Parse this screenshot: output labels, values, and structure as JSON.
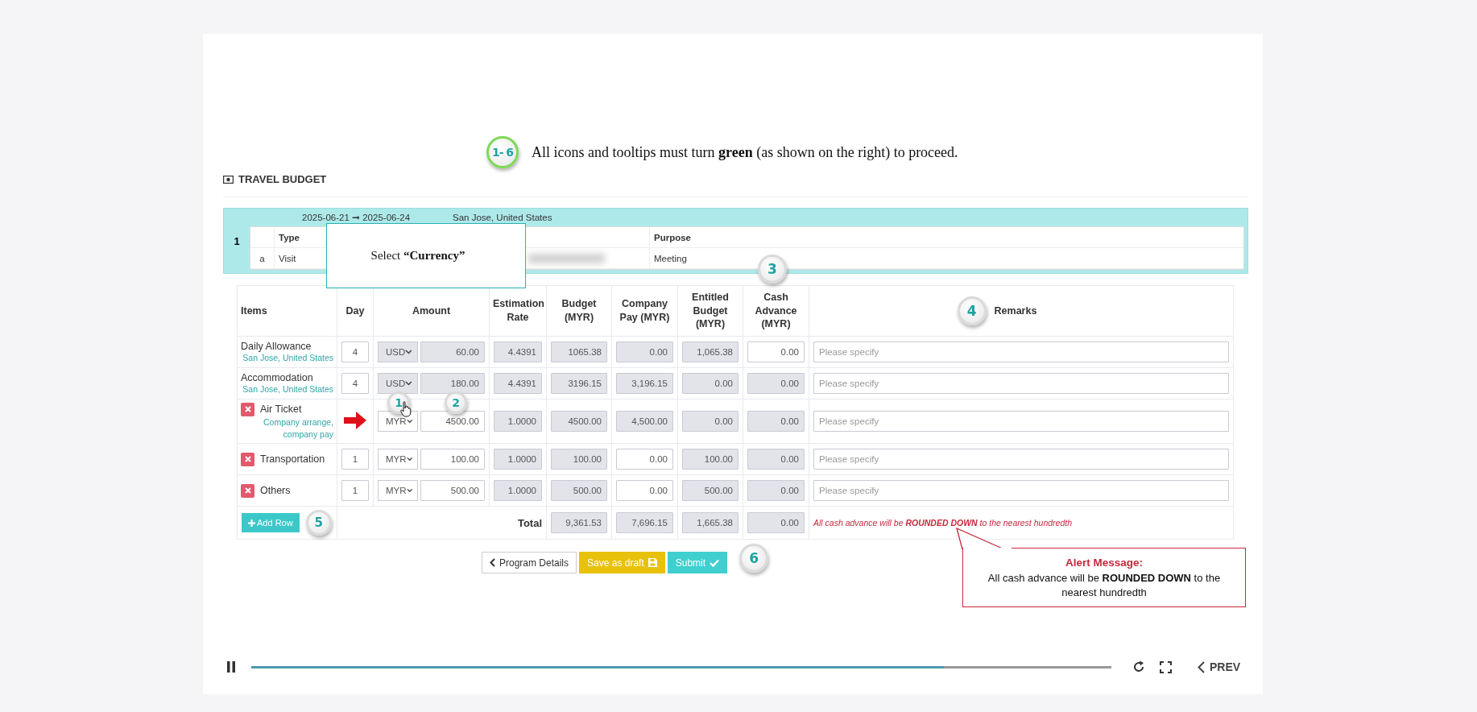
{
  "instruction": {
    "badge": "1- 6",
    "text": "All icons and tooltips must turn **green** (as shown on the right) to proceed."
  },
  "section_title": "TRAVEL BUDGET",
  "trip": {
    "number": "1",
    "dates": "2025-06-21 ➞ 2025-06-24",
    "location": "San Jose, United States",
    "headers": [
      "Type",
      "Purpose"
    ],
    "row": {
      "letter": "a",
      "type": "Visit",
      "purpose": "Meeting"
    }
  },
  "tooltip": "Select **“Currency”**",
  "steps": [
    "1",
    "2",
    "3",
    "4",
    "5",
    "6"
  ],
  "budget_table": {
    "columns": [
      "Items",
      "Day",
      "Amount",
      "Estimation Rate",
      "Budget (MYR)",
      "Company Pay (MYR)",
      "Entitled Budget (MYR)",
      "Cash Advance (MYR)",
      "Remarks"
    ],
    "rows": [
      {
        "kind": "fixed",
        "item": "Daily Allowance",
        "detail": "San Jose, United States",
        "pointer": false,
        "day": "4",
        "currency": "USD",
        "amount": "60.00",
        "locked": true,
        "rate": "4.4391",
        "budget": "1065.38",
        "company_pay": "0.00",
        "company_pay_locked": true,
        "entitled": "1,065.38",
        "cash_advance": "0.00",
        "cash_advance_locked": false,
        "remarks_placeholder": "Please specify"
      },
      {
        "kind": "fixed",
        "item": "Accommodation",
        "detail": "San Jose, United States",
        "pointer": false,
        "day": "4",
        "currency": "USD",
        "amount": "180.00",
        "locked": true,
        "rate": "4.4391",
        "budget": "3196.15",
        "company_pay": "3,196.15",
        "company_pay_locked": true,
        "entitled": "0.00",
        "cash_advance": "0.00",
        "cash_advance_locked": true,
        "remarks_placeholder": "Please specify"
      },
      {
        "kind": "removable",
        "item": "Air Ticket",
        "detail": "Company arrange, company pay",
        "pointer": true,
        "currency": "MYR",
        "amount": "4500.00",
        "locked": false,
        "rate": "1.0000",
        "budget": "4500.00",
        "company_pay": "4,500.00",
        "company_pay_locked": true,
        "entitled": "0.00",
        "cash_advance": "0.00",
        "cash_advance_locked": true,
        "remarks_placeholder": "Please specify"
      },
      {
        "kind": "removable",
        "item": "Transportation",
        "pointer": false,
        "day": "1",
        "currency": "MYR",
        "amount": "100.00",
        "locked": false,
        "rate": "1.0000",
        "budget": "100.00",
        "company_pay": "0.00",
        "company_pay_locked": false,
        "entitled": "100.00",
        "cash_advance": "0.00",
        "cash_advance_locked": true,
        "remarks_placeholder": "Please specify"
      },
      {
        "kind": "removable",
        "item": "Others",
        "pointer": false,
        "day": "1",
        "currency": "MYR",
        "amount": "500.00",
        "locked": false,
        "rate": "1.0000",
        "budget": "500.00",
        "company_pay": "0.00",
        "company_pay_locked": false,
        "entitled": "500.00",
        "cash_advance": "0.00",
        "cash_advance_locked": true,
        "remarks_placeholder": "Please specify"
      }
    ],
    "add_row": "Add Row",
    "total": {
      "label": "Total",
      "budget": "9,361.53",
      "company_pay": "7,696.15",
      "entitled": "1,665.38",
      "cash_advance": "0.00",
      "note": "All cash advance will be **ROUNDED DOWN** to the nearest hundredth"
    }
  },
  "buttons": [
    "Program Details",
    "Save as draft",
    "Submit"
  ],
  "alert": {
    "title": "Alert Message:",
    "text": "All cash advance will be **ROUNDED DOWN** to the nearest hundredth"
  },
  "player": {
    "level": 0.805,
    "prev": "PREV"
  }
}
